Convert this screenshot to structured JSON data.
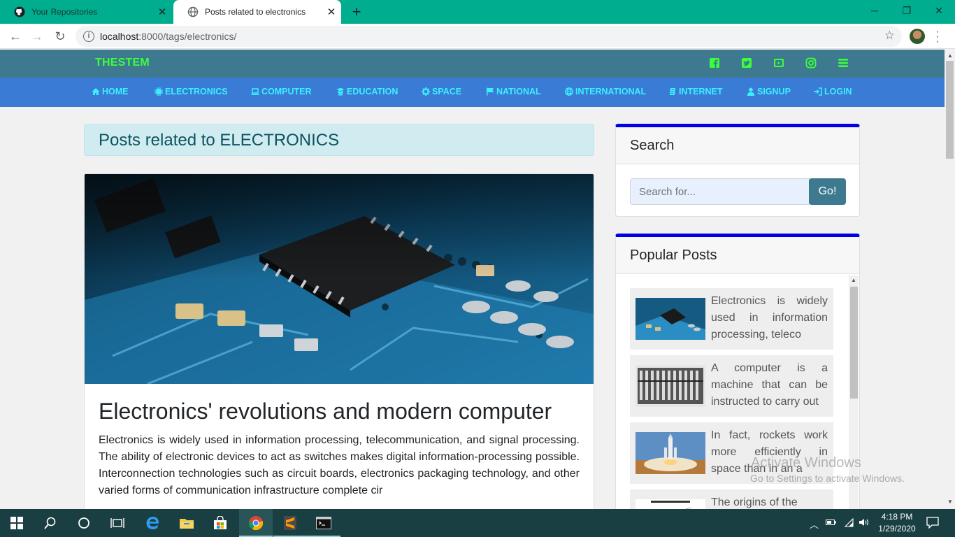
{
  "browser": {
    "tabs": [
      {
        "title": "Your Repositories",
        "active": false
      },
      {
        "title": "Posts related to electronics",
        "active": true
      }
    ],
    "url_host": "localhost",
    "url_rest": ":8000/tags/electronics/",
    "accent": "#00ad8e"
  },
  "site": {
    "brand": "THESTEM",
    "social_icons": [
      "facebook-icon",
      "twitter-icon",
      "youtube-icon",
      "instagram-icon",
      "menu-icon"
    ],
    "nav": [
      {
        "label": "HOME",
        "icon": "home-icon"
      },
      {
        "label": "ELECTRONICS",
        "icon": "chip-icon"
      },
      {
        "label": "COMPUTER",
        "icon": "laptop-icon"
      },
      {
        "label": "EDUCATION",
        "icon": "graduate-icon"
      },
      {
        "label": "SPACE",
        "icon": "cog-icon"
      },
      {
        "label": "NATIONAL",
        "icon": "flag-icon"
      },
      {
        "label": "INTERNATIONAL",
        "icon": "globe-icon"
      },
      {
        "label": "INTERNET",
        "icon": "internet-icon"
      },
      {
        "label": "SIGNUP",
        "icon": "user-icon"
      },
      {
        "label": "LOGIN",
        "icon": "login-icon"
      }
    ],
    "colors": {
      "header": "#3e7a8f",
      "nav": "#3a7bd5",
      "brand": "#3cff3c",
      "nav_text": "#3cf0ff",
      "widget_border": "#0000e6"
    }
  },
  "main": {
    "heading": "Posts related to ELECTRONICS",
    "post": {
      "title": "Electronics' revolutions and modern computer",
      "excerpt": "Electronics is widely used in information processing, telecommunication, and signal processing. The ability of electronic devices to act as switches makes digital information-processing possible. Interconnection technologies such as circuit boards, electronics packaging technology, and other varied forms of communication infrastructure complete cir"
    }
  },
  "sidebar": {
    "search": {
      "title": "Search",
      "placeholder": "Search for...",
      "button": "Go!"
    },
    "popular": {
      "title": "Popular Posts",
      "items": [
        {
          "text": "Electronics is widely used in information processing, teleco"
        },
        {
          "text": "A computer is a machine that can be instructed to carry out"
        },
        {
          "text": "In fact, rockets work more efficiently in space than in an a"
        },
        {
          "text": "The origins of the"
        }
      ]
    }
  },
  "watermark": {
    "line1": "Activate Windows",
    "line2": "Go to Settings to activate Windows."
  },
  "taskbar": {
    "time": "4:18 PM",
    "date": "1/29/2020"
  }
}
